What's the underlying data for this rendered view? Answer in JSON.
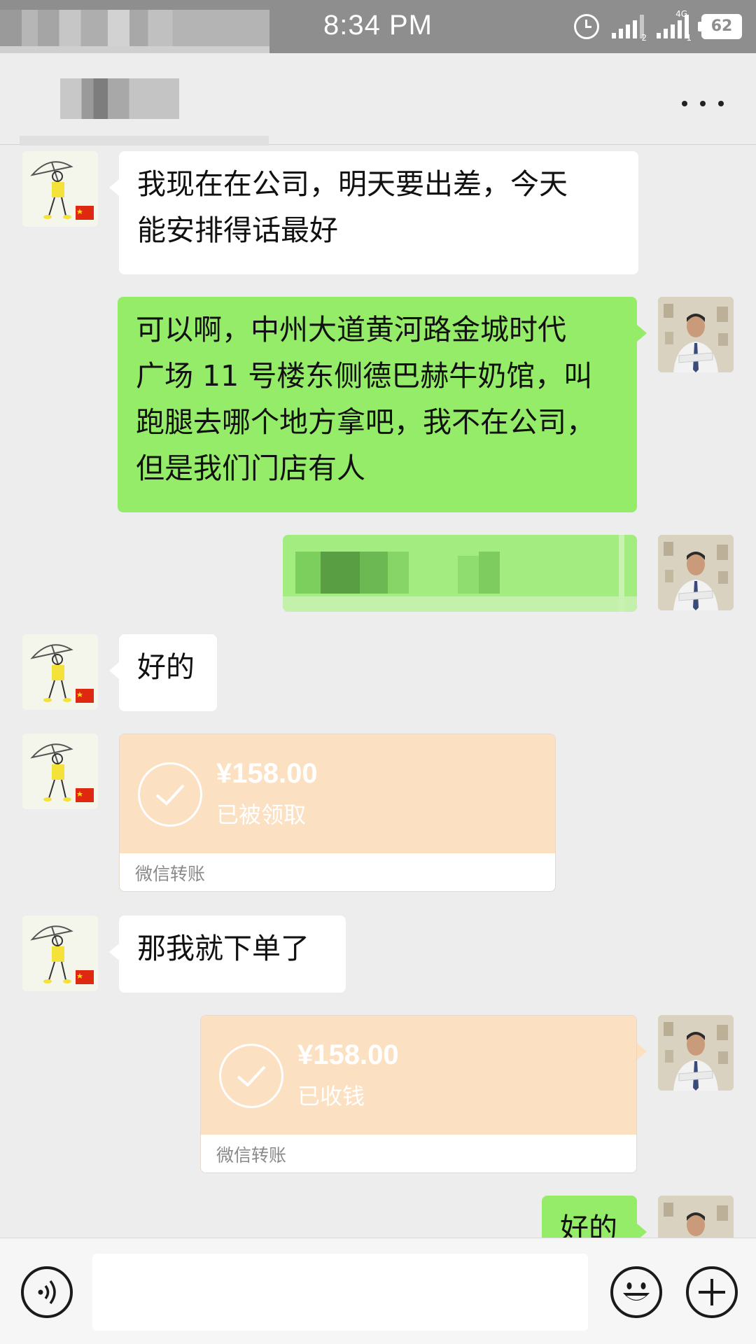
{
  "status_bar": {
    "time": "8:34 PM",
    "battery": "62",
    "network": "4G",
    "sim1_index": "2",
    "sim2_index": "1"
  },
  "header": {
    "more_label": "..."
  },
  "messages": [
    {
      "side": "in",
      "lines": [
        "我现在在公司，明天要出差，今天",
        "能安排得话最好"
      ]
    },
    {
      "side": "out",
      "lines": [
        "可以啊，中州大道黄河路金城时代",
        "广场 11 号楼东侧德巴赫牛奶馆，叫",
        "跑腿去哪个地方拿吧，我不在公司，",
        "但是我们门店有人"
      ]
    },
    {
      "side": "in",
      "lines": [
        "好的"
      ]
    },
    {
      "side": "in",
      "lines": [
        "那我就下单了"
      ]
    },
    {
      "side": "out",
      "lines": [
        "好的"
      ]
    }
  ],
  "transfers": [
    {
      "side": "in",
      "amount": "¥158.00",
      "state": "已被领取",
      "footer": "微信转账"
    },
    {
      "side": "out",
      "amount": "¥158.00",
      "state": "已收钱",
      "footer": "微信转账"
    }
  ],
  "colors": {
    "outgoing": "#95ec69",
    "incoming": "#ffffff",
    "transfer": "#fce0c2",
    "background": "#ededed"
  },
  "icons": {
    "voice": "voice-icon",
    "emoji": "emoji-icon",
    "plus": "plus-icon",
    "more": "more-icon"
  }
}
